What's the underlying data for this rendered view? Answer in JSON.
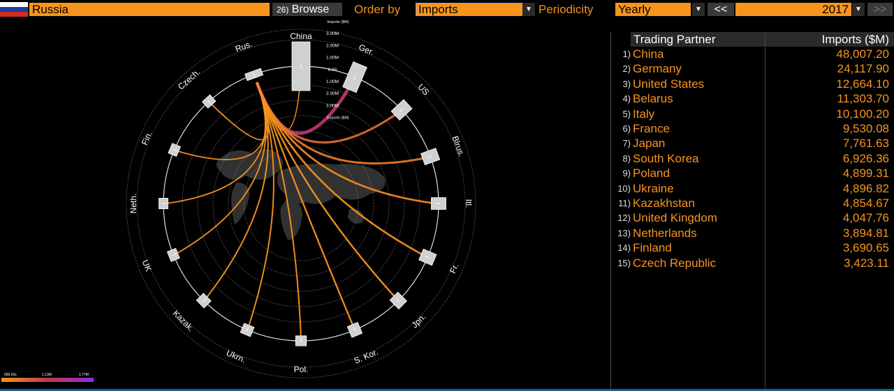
{
  "toolbar": {
    "country": "Russia",
    "browse_count": "26)",
    "browse_label": "Browse",
    "order_by_label": "Order by",
    "order_by_value": "Imports",
    "periodicity_label": "Periodicity",
    "periodicity_value": "Yearly",
    "prev_label": "<<",
    "year": "2017",
    "next_label": ">>"
  },
  "table": {
    "col_partner": "Trading Partner",
    "col_imports": "Imports ($M)",
    "rows": [
      {
        "rank": "1)",
        "name": "China",
        "value": "48,007.20"
      },
      {
        "rank": "2)",
        "name": "Germany",
        "value": "24,117.90"
      },
      {
        "rank": "3)",
        "name": "United States",
        "value": "12,664.10"
      },
      {
        "rank": "4)",
        "name": "Belarus",
        "value": "11,303.70"
      },
      {
        "rank": "5)",
        "name": "Italy",
        "value": "10,100.20"
      },
      {
        "rank": "6)",
        "name": "France",
        "value": "9,530.08"
      },
      {
        "rank": "7)",
        "name": "Japan",
        "value": "7,761.63"
      },
      {
        "rank": "8)",
        "name": "South Korea",
        "value": "6,926.36"
      },
      {
        "rank": "9)",
        "name": "Poland",
        "value": "4,899.31"
      },
      {
        "rank": "10)",
        "name": "Ukraine",
        "value": "4,896.82"
      },
      {
        "rank": "11)",
        "name": "Kazakhstan",
        "value": "4,854.67"
      },
      {
        "rank": "12)",
        "name": "United Kingdom",
        "value": "4,047.76"
      },
      {
        "rank": "13)",
        "name": "Netherlands",
        "value": "3,894.81"
      },
      {
        "rank": "14)",
        "name": "Finland",
        "value": "3,690.65"
      },
      {
        "rank": "15)",
        "name": "Czech Republic",
        "value": "3,423.11"
      }
    ]
  },
  "chart_data": {
    "type": "chord",
    "origin": "Rus.",
    "partners": [
      {
        "label": "China",
        "imports_musd": 48007.2
      },
      {
        "label": "Ger.",
        "imports_musd": 24117.9
      },
      {
        "label": "US",
        "imports_musd": 12664.1
      },
      {
        "label": "Blrus.",
        "imports_musd": 11303.7
      },
      {
        "label": "Itl.",
        "imports_musd": 10100.2
      },
      {
        "label": "Fr.",
        "imports_musd": 9530.08
      },
      {
        "label": "Jpn.",
        "imports_musd": 7761.63
      },
      {
        "label": "S. Kor.",
        "imports_musd": 6926.36
      },
      {
        "label": "Pol.",
        "imports_musd": 4899.31
      },
      {
        "label": "Ukrn.",
        "imports_musd": 4896.82
      },
      {
        "label": "Kazak.",
        "imports_musd": 4854.67
      },
      {
        "label": "UK",
        "imports_musd": 4047.76
      },
      {
        "label": "Neth.",
        "imports_musd": 3894.81
      },
      {
        "label": "Fin.",
        "imports_musd": 3690.65
      },
      {
        "label": "Czech.",
        "imports_musd": 3423.11
      }
    ],
    "scale_labels": [
      "Imports ($M)",
      "3.00M",
      "2.00M",
      "1.00M",
      "0.00",
      "1.00M",
      "2.00M",
      "3.00M",
      "Exports ($M)"
    ],
    "color_scale": {
      "labels": [
        "586.91k",
        "1.13M",
        "1.77M"
      ],
      "colors": [
        "#f7941d",
        "#c0394a",
        "#8e2de2"
      ]
    }
  }
}
